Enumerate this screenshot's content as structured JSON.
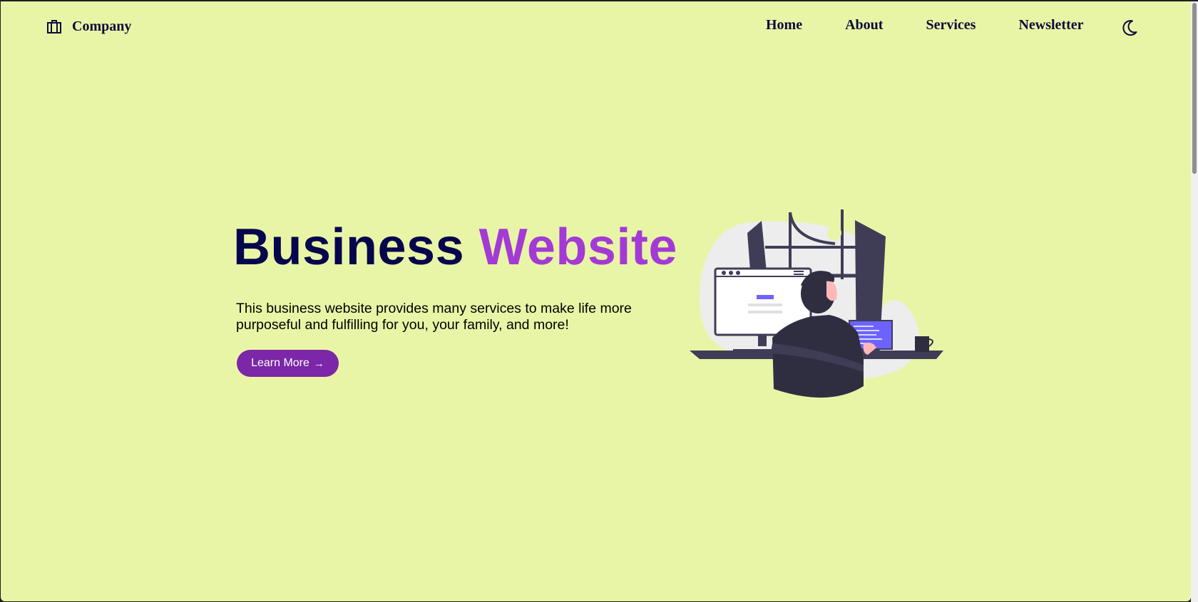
{
  "header": {
    "brand_icon": "briefcase-icon",
    "brand_name": "Company",
    "nav": [
      "Home",
      "About",
      "Services",
      "Newsletter"
    ],
    "theme_icon": "moon-icon"
  },
  "hero": {
    "title_main": "Business",
    "title_accent": "Website",
    "description": "This business website provides many services to make life more purposeful and fulfilling for you, your family, and more!",
    "cta_label": "Learn More",
    "cta_icon": "arrow-right-icon",
    "illustration": "person-at-computer-illustration"
  },
  "colors": {
    "background": "#e9f5a6",
    "heading": "#06064d",
    "accent": "#a33ad6",
    "button": "#7b27a8"
  }
}
